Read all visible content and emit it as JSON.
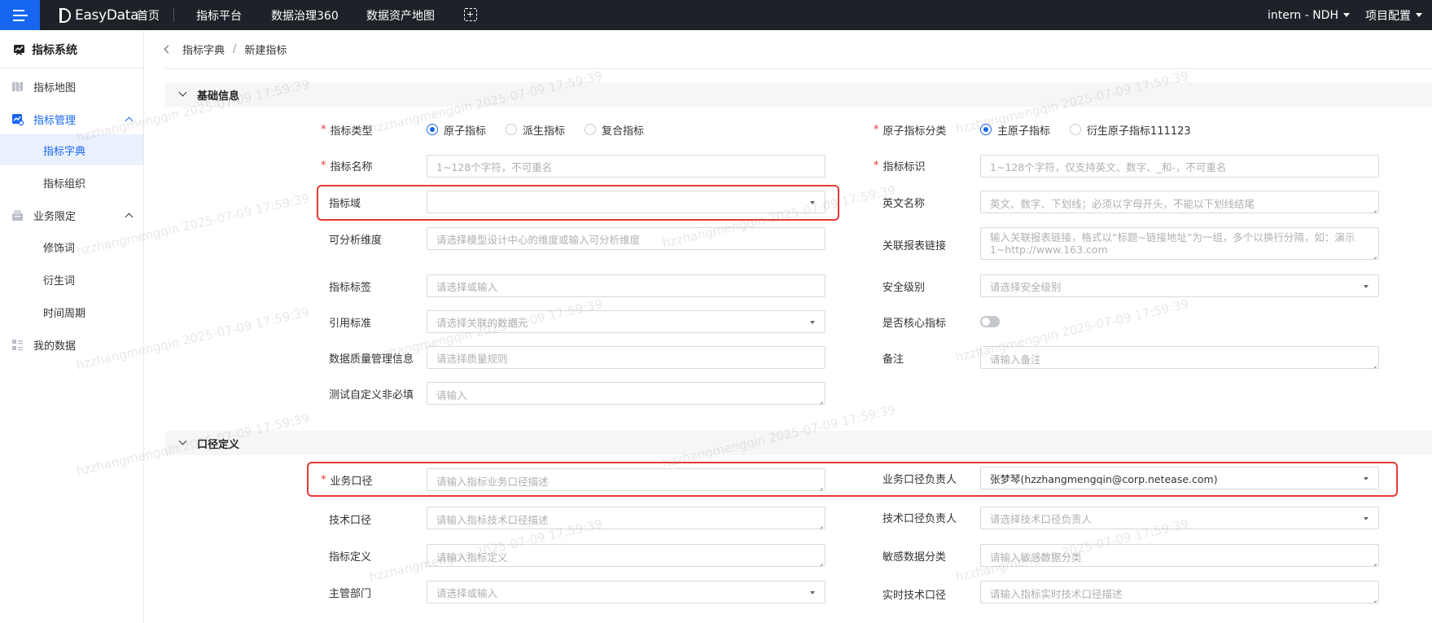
{
  "topbar": {
    "logo": "EasyData",
    "nav": [
      "首页",
      "指标平台",
      "数据治理360",
      "数据资产地图"
    ],
    "project": "intern - NDH",
    "config": "项目配置"
  },
  "sidebar": {
    "title": "指标系统",
    "items": [
      {
        "label": "指标地图"
      },
      {
        "label": "指标管理"
      },
      {
        "label": "指标字典"
      },
      {
        "label": "指标组织"
      },
      {
        "label": "业务限定"
      },
      {
        "label": "修饰词"
      },
      {
        "label": "衍生词"
      },
      {
        "label": "时间周期"
      },
      {
        "label": "我的数据"
      }
    ]
  },
  "breadcrumb": {
    "parent": "指标字典",
    "sep": "/",
    "current": "新建指标"
  },
  "sections": {
    "basic": "基础信息",
    "caliber": "口径定义"
  },
  "form": {
    "type": {
      "label": "指标类型",
      "options": [
        "原子指标",
        "派生指标",
        "复合指标"
      ]
    },
    "atomic_cat": {
      "label": "原子指标分类",
      "options": [
        "主原子指标",
        "衍生原子指标111123"
      ]
    },
    "name": {
      "label": "指标名称",
      "placeholder": "1~128个字符，不可重名"
    },
    "code": {
      "label": "指标标识",
      "placeholder": "1~128个字符，仅支持英文、数字、_和-，不可重名"
    },
    "domain": {
      "label": "指标域",
      "value": ""
    },
    "en_name": {
      "label": "英文名称",
      "placeholder": "英文、数字、下划线；必须以字母开头，不能以下划线结尾"
    },
    "dims": {
      "label": "可分析维度",
      "placeholder": "请选择模型设计中心的维度或输入可分析维度"
    },
    "report_link": {
      "label": "关联报表链接",
      "placeholder": "输入关联报表链接，格式以“标题~链接地址”为一组，多个以换行分隔，如：演示1~http://www.163.com"
    },
    "tags": {
      "label": "指标标签",
      "placeholder": "请选择或输入"
    },
    "security": {
      "label": "安全级别",
      "placeholder": "请选择安全级别"
    },
    "standard": {
      "label": "引用标准",
      "placeholder": "请选择关联的数据元"
    },
    "core": {
      "label": "是否核心指标"
    },
    "quality": {
      "label": "数据质量管理信息",
      "placeholder": "请选择质量规则"
    },
    "remark": {
      "label": "备注",
      "placeholder": "请输入备注"
    },
    "custom": {
      "label": "测试自定义非必填",
      "placeholder": "请输入"
    },
    "biz_caliber": {
      "label": "业务口径",
      "placeholder": "请输入指标业务口径描述"
    },
    "biz_owner": {
      "label": "业务口径负责人",
      "value": "张梦琴(hzzhangmengqin@corp.netease.com)"
    },
    "tech_caliber": {
      "label": "技术口径",
      "placeholder": "请输入指标技术口径描述"
    },
    "tech_owner": {
      "label": "技术口径负责人",
      "placeholder": "请选择技术口径负责人"
    },
    "definition": {
      "label": "指标定义",
      "placeholder": "请输入指标定义"
    },
    "sensitive": {
      "label": "敏感数据分类",
      "placeholder": "请输入敏感数据分类"
    },
    "dept": {
      "label": "主管部门",
      "placeholder": "请选择或输入"
    },
    "realtime": {
      "label": "实时技术口径",
      "placeholder": "请输入指标实时技术口径描述"
    }
  },
  "watermark": "hzzhangmengqin 2025-07-09 17:59:39",
  "colors": {
    "accent": "#1766f0",
    "topbar": "#1e2127",
    "highlight": "#e53935",
    "required": "#e53935"
  }
}
